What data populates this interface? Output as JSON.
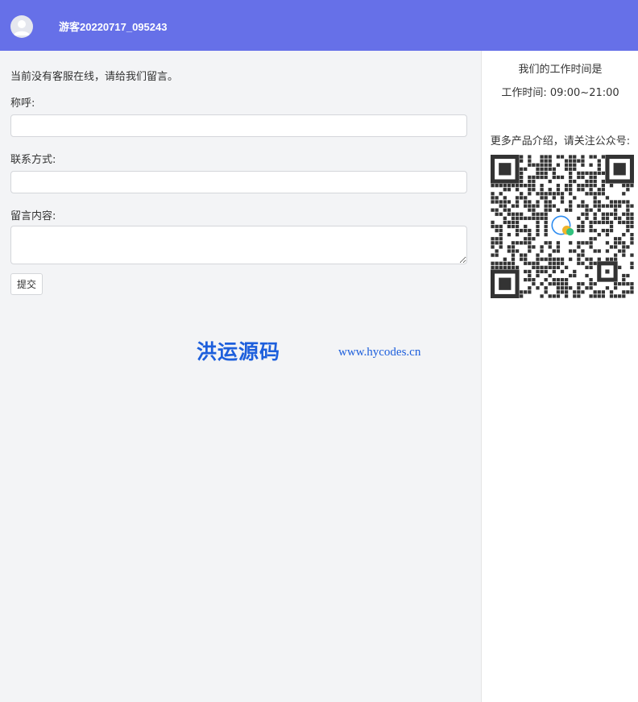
{
  "header": {
    "username": "游客20220717_095243",
    "avatar_icon": "user-avatar-icon",
    "background_color": "#6670e8"
  },
  "form": {
    "notice": "当前没有客服在线，请给我们留言。",
    "name_label": "称呼:",
    "name_value": "",
    "contact_label": "联系方式:",
    "contact_value": "",
    "message_label": "留言内容:",
    "message_value": "",
    "submit_label": "提交"
  },
  "watermark": {
    "name": "洪运源码",
    "url": "www.hycodes.cn",
    "color": "#1d5fdc"
  },
  "sidebar": {
    "hours_title": "我们的工作时间是",
    "hours_value": "工作时间: 09:00~21:00",
    "follow_text": "更多产品介绍，请关注公众号:",
    "qr_icon": "wechat-qr-code-icon"
  }
}
